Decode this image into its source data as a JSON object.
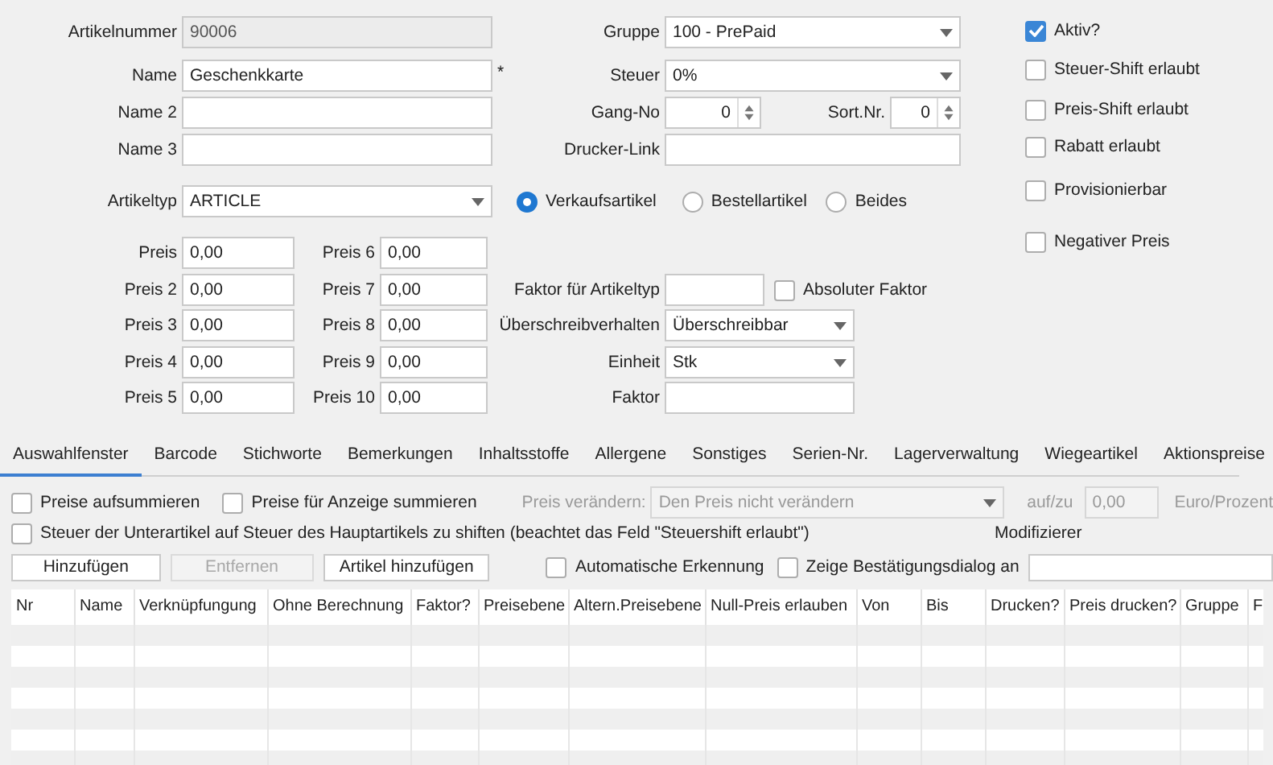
{
  "artikelnummer": {
    "label": "Artikelnummer",
    "value": "90006",
    "disabled": true
  },
  "name": {
    "label": "Name",
    "value": "Geschenkkarte",
    "required_mark": "*"
  },
  "name_2": {
    "label": "Name 2"
  },
  "name_3": {
    "label": "Name 3"
  },
  "gruppe": {
    "label": "Gruppe",
    "value": "100 - PrePaid"
  },
  "steuer": {
    "label": "Steuer",
    "value": "0%"
  },
  "gang_no": {
    "label": "Gang-No",
    "value": "0"
  },
  "sort_nr": {
    "label": "Sort.Nr.",
    "value": "0"
  },
  "drucker_link": {
    "label": "Drucker-Link"
  },
  "artikeltyp": {
    "label": "Artikeltyp",
    "value": "ARTICLE"
  },
  "article_kind": [
    {
      "label": "Verkaufsartikel",
      "selected": true
    },
    {
      "label": "Bestellartikel",
      "selected": false
    },
    {
      "label": "Beides",
      "selected": false
    }
  ],
  "flags": [
    {
      "label": "Aktiv?",
      "checked": true
    },
    {
      "label": "Steuer-Shift erlaubt",
      "checked": false
    },
    {
      "label": "Preis-Shift erlaubt",
      "checked": false
    },
    {
      "label": "Rabatt erlaubt",
      "checked": false
    },
    {
      "label": "Provisionierbar",
      "checked": false
    },
    {
      "label": "Negativer Preis",
      "checked": false
    }
  ],
  "prices": [
    {
      "label": "Preis",
      "value": "0,00"
    },
    {
      "label": "Preis 2",
      "value": "0,00"
    },
    {
      "label": "Preis 3",
      "value": "0,00"
    },
    {
      "label": "Preis 4",
      "value": "0,00"
    },
    {
      "label": "Preis 5",
      "value": "0,00"
    },
    {
      "label": "Preis 6",
      "value": "0,00"
    },
    {
      "label": "Preis 7",
      "value": "0,00"
    },
    {
      "label": "Preis 8",
      "value": "0,00"
    },
    {
      "label": "Preis 9",
      "value": "0,00"
    },
    {
      "label": "Preis 10",
      "value": "0,00"
    }
  ],
  "faktor_fuer_artikeltyp": {
    "label": "Faktor für Artikeltyp"
  },
  "absoluter_faktor": {
    "label": "Absoluter Faktor",
    "checked": false
  },
  "ueberschreibverhalten": {
    "label": "Überschreibverhalten",
    "value": "Überschreibbar"
  },
  "einheit": {
    "label": "Einheit",
    "value": "Stk"
  },
  "faktor": {
    "label": "Faktor"
  },
  "tabs": [
    {
      "label": "Auswahlfenster",
      "selected": true
    },
    {
      "label": "Barcode",
      "selected": false
    },
    {
      "label": "Stichworte",
      "selected": false
    },
    {
      "label": "Bemerkungen",
      "selected": false
    },
    {
      "label": "Inhaltsstoffe",
      "selected": false
    },
    {
      "label": "Allergene",
      "selected": false
    },
    {
      "label": "Sonstiges",
      "selected": false
    },
    {
      "label": "Serien-Nr.",
      "selected": false
    },
    {
      "label": "Lagerverwaltung",
      "selected": false
    },
    {
      "label": "Wiegeartikel",
      "selected": false
    },
    {
      "label": "Aktionspreise",
      "selected": false
    }
  ],
  "options": {
    "preise_aufsummieren": {
      "label": "Preise aufsummieren",
      "checked": false
    },
    "preise_fuer_anzeige": {
      "label": "Preise für Anzeige summieren",
      "checked": false
    },
    "preis_veraendern": {
      "label": "Preis verändern:",
      "value": "Den Preis nicht verändern",
      "disabled": true
    },
    "auf_zu": {
      "label": "auf/zu",
      "value": "0,00",
      "disabled": true
    },
    "unit_label": "Euro/Prozent",
    "steuer_shift": {
      "label": "Steuer der Unterartikel auf Steuer des Hauptartikels zu shiften (beachtet das Feld \"Steuershift erlaubt\")",
      "checked": false
    },
    "modifizierer": {
      "label": "Modifizierer"
    },
    "automatische_erkennung": {
      "label": "Automatische Erkennung",
      "checked": false
    },
    "bestaetigungsdialog": {
      "label": "Zeige Bestätigungsdialog an",
      "checked": false
    }
  },
  "buttons": [
    {
      "label": "Hinzufügen",
      "disabled": false
    },
    {
      "label": "Entfernen",
      "disabled": true
    },
    {
      "label": "Artikel hinzufügen",
      "disabled": false
    }
  ],
  "table": {
    "columns": [
      "Nr",
      "Name",
      "Verknüpfungung",
      "Ohne Berechnung",
      "Faktor?",
      "Preisebene",
      "Altern.Preisebene",
      "Null-Preis erlauben",
      "Von",
      "Bis",
      "Drucken?",
      "Preis drucken?",
      "Gruppe",
      "F"
    ]
  }
}
